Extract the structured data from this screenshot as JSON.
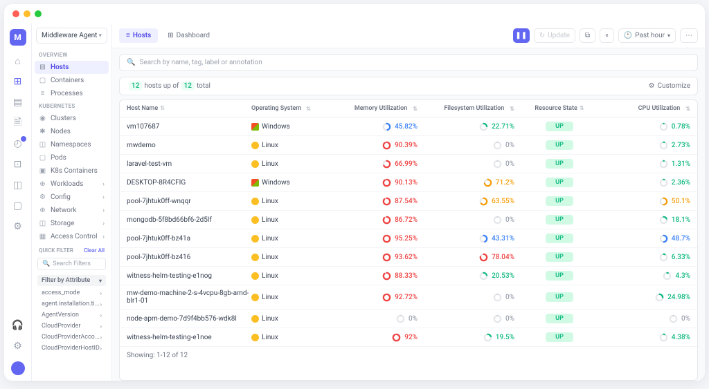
{
  "agent_selector": "Middleware Agent",
  "sidebar": {
    "overview_label": "OVERVIEW",
    "overview_items": [
      "Hosts",
      "Containers",
      "Processes"
    ],
    "k8s_label": "KUBERNETES",
    "k8s_items": [
      "Clusters",
      "Nodes",
      "Namespaces",
      "Pods",
      "K8s Containers",
      "Workloads",
      "Config",
      "Network",
      "Storage",
      "Access Control"
    ],
    "k8s_expandable": [
      false,
      false,
      false,
      false,
      false,
      true,
      true,
      true,
      true,
      true
    ],
    "quick_label": "QUICK FILTER",
    "clear_all": "Clear All",
    "search_placeholder": "Search Filters",
    "filter_header": "Filter by Attribute",
    "filters": [
      "access_mode",
      "agent.installation.ti...",
      "AgentVersion",
      "CloudProvider",
      "CloudProviderAcco...",
      "CloudProviderHostID"
    ]
  },
  "tabs": {
    "hosts": "Hosts",
    "dashboard": "Dashboard"
  },
  "topbar": {
    "update": "Update",
    "past_hour": "Past hour"
  },
  "search_placeholder": "Search by name, tag, label or annotation",
  "summary": {
    "count": "12",
    "mid": "hosts up of",
    "total": "12",
    "suffix": "total",
    "customize": "Customize"
  },
  "columns": {
    "host": "Host Name",
    "os": "Operating System",
    "mem": "Memory Utilization",
    "fs": "Filesystem Utilization",
    "rs": "Resource State",
    "cpu": "CPU Utilization"
  },
  "rows": [
    {
      "host": "vm107687",
      "os": "Windows",
      "mem": "45.82%",
      "mem_c": "blue",
      "fs": "22.71%",
      "fs_c": "green",
      "rs": "UP",
      "cpu": "0.78%",
      "cpu_c": "green"
    },
    {
      "host": "mwdemo",
      "os": "Linux",
      "mem": "90.39%",
      "mem_c": "red",
      "fs": "0%",
      "fs_c": "gray",
      "rs": "UP",
      "cpu": "2.73%",
      "cpu_c": "green"
    },
    {
      "host": "laravel-test-vm",
      "os": "Linux",
      "mem": "66.99%",
      "mem_c": "red",
      "fs": "0%",
      "fs_c": "gray",
      "rs": "UP",
      "cpu": "1.31%",
      "cpu_c": "green"
    },
    {
      "host": "DESKTOP-8R4CFIG",
      "os": "Windows",
      "mem": "90.13%",
      "mem_c": "red",
      "fs": "71.2%",
      "fs_c": "orange",
      "rs": "UP",
      "cpu": "2.36%",
      "cpu_c": "green"
    },
    {
      "host": "pool-7jhtuk0ff-wnqqr",
      "os": "Linux",
      "mem": "87.54%",
      "mem_c": "red",
      "fs": "63.55%",
      "fs_c": "orange",
      "rs": "UP",
      "cpu": "50.1%",
      "cpu_c": "orange"
    },
    {
      "host": "mongodb-5f8bd66bf6-2d5lf",
      "os": "Linux",
      "mem": "86.72%",
      "mem_c": "red",
      "fs": "0%",
      "fs_c": "gray",
      "rs": "UP",
      "cpu": "18.1%",
      "cpu_c": "green"
    },
    {
      "host": "pool-7jhtuk0ff-bz41a",
      "os": "Linux",
      "mem": "95.25%",
      "mem_c": "red",
      "fs": "43.31%",
      "fs_c": "blue",
      "rs": "UP",
      "cpu": "48.7%",
      "cpu_c": "blue"
    },
    {
      "host": "pool-7jhtuk0ff-bz416",
      "os": "Linux",
      "mem": "93.62%",
      "mem_c": "red",
      "fs": "78.04%",
      "fs_c": "red",
      "rs": "UP",
      "cpu": "6.33%",
      "cpu_c": "green"
    },
    {
      "host": "witness-helm-testing-e1nog",
      "os": "Linux",
      "mem": "88.33%",
      "mem_c": "red",
      "fs": "20.53%",
      "fs_c": "green",
      "rs": "UP",
      "cpu": "4.3%",
      "cpu_c": "green"
    },
    {
      "host": "mw-demo-machine-2-s-4vcpu-8gb-amd-blr1-01",
      "os": "Linux",
      "mem": "92.72%",
      "mem_c": "red",
      "fs": "0%",
      "fs_c": "gray",
      "rs": "UP",
      "cpu": "24.98%",
      "cpu_c": "green"
    },
    {
      "host": "node-apm-demo-7d9f4bb576-wdk8l",
      "os": "Linux",
      "mem": "0%",
      "mem_c": "gray",
      "fs": "0%",
      "fs_c": "gray",
      "rs": "UP",
      "cpu": "0%",
      "cpu_c": "gray"
    },
    {
      "host": "witness-helm-testing-e1noe",
      "os": "Linux",
      "mem": "92%",
      "mem_c": "red",
      "fs": "19.5%",
      "fs_c": "green",
      "rs": "UP",
      "cpu": "4.38%",
      "cpu_c": "green"
    }
  ],
  "footer": "Showing: 1-12 of 12",
  "ring_colors": {
    "red": "#ef4444",
    "blue": "#3b82f6",
    "green": "#10b981",
    "orange": "#f59e0b",
    "gray": "#d1d5db"
  }
}
